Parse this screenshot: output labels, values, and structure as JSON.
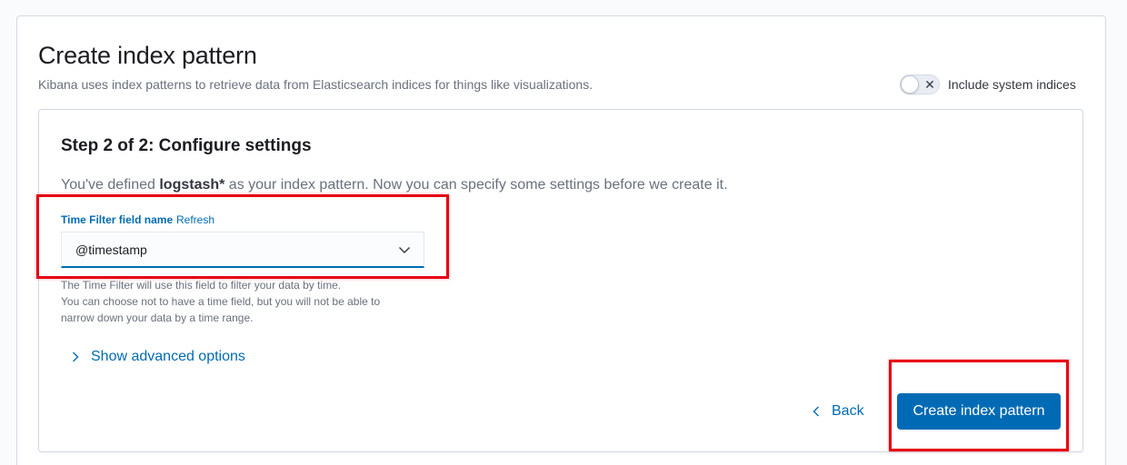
{
  "page": {
    "title": "Create index pattern",
    "description": "Kibana uses index patterns to retrieve data from Elasticsearch indices for things like visualizations.",
    "include_system_indices_label": "Include system indices"
  },
  "step": {
    "title": "Step 2 of 2: Configure settings",
    "desc_prefix": "You've defined ",
    "pattern": "logstash*",
    "desc_suffix": " as your index pattern. Now you can specify some settings before we create it."
  },
  "time_filter": {
    "label": "Time Filter field name",
    "refresh_label": "Refresh",
    "selected_value": "@timestamp",
    "help_line1": "The Time Filter will use this field to filter your data by time.",
    "help_line2": "You can choose not to have a time field, but you will not be able to",
    "help_line3": "narrow down your data by a time range."
  },
  "advanced": {
    "label": "Show advanced options"
  },
  "actions": {
    "back_label": "Back",
    "create_label": "Create index pattern"
  },
  "colors": {
    "primary": "#006bb4",
    "highlight": "#e60012"
  },
  "icons": {
    "toggle_off": "cross-icon",
    "select": "chevron-down-icon",
    "advanced": "chevron-right-icon",
    "back": "chevron-left-icon"
  }
}
